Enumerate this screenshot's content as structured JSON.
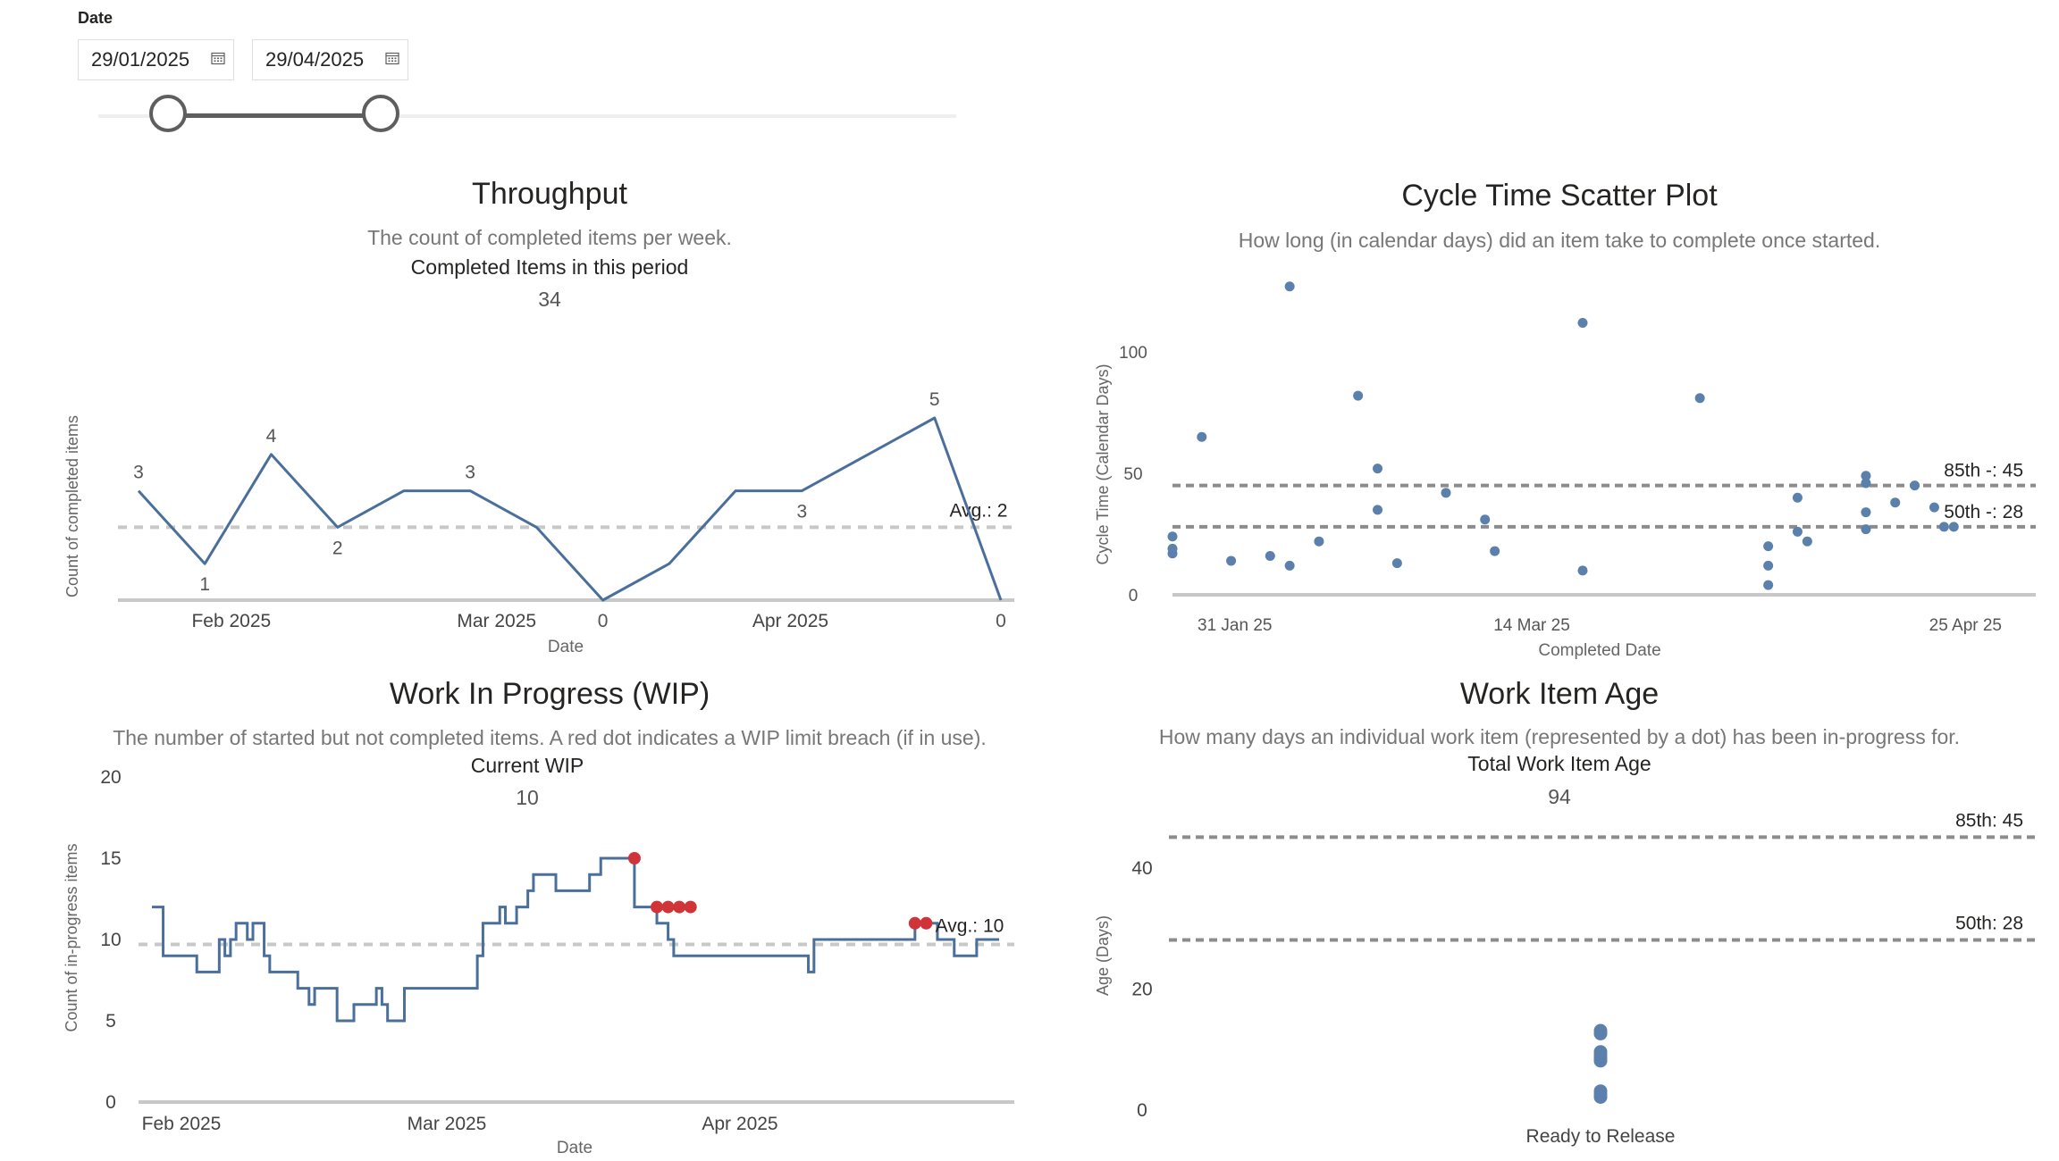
{
  "filter": {
    "label": "Date",
    "start_date": "29/01/2025",
    "end_date": "29/04/2025",
    "slider_start_fraction": 0.0,
    "slider_end_fraction": 1.0
  },
  "colors": {
    "series": "#4a6f9b",
    "dot": "#5b80ab",
    "breach": "#d13438",
    "axis": "#c8c8c8",
    "avg_line": "#c8c8c8",
    "percentile_line": "#8c8c8c"
  },
  "throughput": {
    "title": "Throughput",
    "subtitle": "The count of completed items per week.",
    "kpi_label": "Completed Items in this period",
    "kpi_value": "34"
  },
  "cycle_time": {
    "title": "Cycle Time Scatter Plot",
    "subtitle": "How long (in calendar days) did an item take to complete once started."
  },
  "wip": {
    "title": "Work In Progress (WIP)",
    "subtitle": "The number of started but not completed items. A red dot indicates a WIP limit breach (if in use).",
    "kpi_label": "Current WIP",
    "kpi_value": "10"
  },
  "work_item_age": {
    "title": "Work Item Age",
    "subtitle": "How many days an individual work item (represented by a dot) has been in-progress for.",
    "kpi_label": "Total Work Item Age",
    "kpi_value": "94"
  },
  "chart_data": [
    {
      "id": "throughput",
      "type": "line",
      "x": [
        "2025-01-29",
        "2025-02-05",
        "2025-02-12",
        "2025-02-19",
        "2025-02-26",
        "2025-03-05",
        "2025-03-12",
        "2025-03-19",
        "2025-03-26",
        "2025-04-02",
        "2025-04-09",
        "2025-04-16",
        "2025-04-23",
        "2025-04-30"
      ],
      "series": [
        {
          "values": [
            3,
            1,
            4,
            2,
            3,
            3,
            2,
            0,
            1,
            3,
            3,
            4,
            5,
            0
          ]
        }
      ],
      "data_labels": [
        {
          "index": 0,
          "text": "3"
        },
        {
          "index": 1,
          "text": "1"
        },
        {
          "index": 2,
          "text": "4"
        },
        {
          "index": 3,
          "text": "2"
        },
        {
          "index": 5,
          "text": "3"
        },
        {
          "index": 7,
          "text": "0"
        },
        {
          "index": 10,
          "text": "3"
        },
        {
          "index": 12,
          "text": "5"
        },
        {
          "index": 13,
          "text": "0"
        }
      ],
      "average": 2,
      "average_label": "Avg.: 2",
      "xlabel": "Date",
      "ylabel": "Count of completed items",
      "x_ticks": [
        "Feb 2025",
        "Mar 2025",
        "Apr 2025"
      ],
      "x_tick_dates": [
        "2025-02-01",
        "2025-03-01",
        "2025-04-01"
      ],
      "ylim": [
        0,
        5.5
      ],
      "grid": false
    },
    {
      "id": "cycle_time",
      "type": "scatter",
      "xlabel": "Completed Date",
      "ylabel": "Cycle Time (Calendar Days)",
      "x_ticks": [
        "31 Jan 25",
        "14 Mar 25",
        "25 Apr 25"
      ],
      "x_tick_dates": [
        "2025-01-31",
        "2025-03-14",
        "2025-04-25"
      ],
      "y_ticks": [
        0,
        50,
        100
      ],
      "ylim": [
        0,
        128
      ],
      "points": [
        [
          "2025-01-31",
          24
        ],
        [
          "2025-01-31",
          19
        ],
        [
          "2025-01-31",
          17
        ],
        [
          "2025-02-03",
          65
        ],
        [
          "2025-02-06",
          14
        ],
        [
          "2025-02-10",
          16
        ],
        [
          "2025-02-12",
          12
        ],
        [
          "2025-02-12",
          127
        ],
        [
          "2025-02-15",
          22
        ],
        [
          "2025-02-19",
          82
        ],
        [
          "2025-02-21",
          52
        ],
        [
          "2025-02-21",
          35
        ],
        [
          "2025-02-23",
          13
        ],
        [
          "2025-02-28",
          42
        ],
        [
          "2025-03-04",
          31
        ],
        [
          "2025-03-05",
          18
        ],
        [
          "2025-03-14",
          10
        ],
        [
          "2025-03-14",
          112
        ],
        [
          "2025-03-26",
          81
        ],
        [
          "2025-04-02",
          20
        ],
        [
          "2025-04-02",
          12
        ],
        [
          "2025-04-02",
          4
        ],
        [
          "2025-04-05",
          40
        ],
        [
          "2025-04-05",
          26
        ],
        [
          "2025-04-06",
          22
        ],
        [
          "2025-04-12",
          46
        ],
        [
          "2025-04-12",
          49
        ],
        [
          "2025-04-12",
          34
        ],
        [
          "2025-04-12",
          27
        ],
        [
          "2025-04-15",
          38
        ],
        [
          "2025-04-17",
          45
        ],
        [
          "2025-04-19",
          36
        ],
        [
          "2025-04-20",
          28
        ],
        [
          "2025-04-21",
          28
        ]
      ],
      "percentiles": [
        {
          "label": "85th -: 45",
          "value": 45
        },
        {
          "label": "50th -: 28",
          "value": 28
        }
      ],
      "grid": false
    },
    {
      "id": "wip",
      "type": "line",
      "step": true,
      "xlabel": "Date",
      "ylabel": "Count of in-progress items",
      "x_ticks": [
        "Feb 2025",
        "Mar 2025",
        "Apr 2025"
      ],
      "x_tick_dates": [
        "2025-02-01",
        "2025-03-01",
        "2025-04-01"
      ],
      "y_ticks": [
        0,
        5,
        10,
        15,
        20
      ],
      "ylim": [
        0,
        20
      ],
      "series": [
        {
          "points": [
            [
              "2025-01-29",
              12
            ],
            [
              "2025-01-31",
              9
            ],
            [
              "2025-02-06",
              8
            ],
            [
              "2025-02-10",
              10
            ],
            [
              "2025-02-11",
              9
            ],
            [
              "2025-02-12",
              10
            ],
            [
              "2025-02-13",
              11
            ],
            [
              "2025-02-15",
              10
            ],
            [
              "2025-02-16",
              11
            ],
            [
              "2025-02-18",
              9
            ],
            [
              "2025-02-19",
              8
            ],
            [
              "2025-02-24",
              7
            ],
            [
              "2025-02-26",
              6
            ],
            [
              "2025-02-27",
              7
            ],
            [
              "2025-03-03",
              5
            ],
            [
              "2025-03-06",
              6
            ],
            [
              "2025-03-10",
              7
            ],
            [
              "2025-03-11",
              6
            ],
            [
              "2025-03-12",
              5
            ],
            [
              "2025-03-15",
              7
            ],
            [
              "2025-03-28",
              9
            ],
            [
              "2025-03-29",
              11
            ],
            [
              "2025-04-01",
              12
            ],
            [
              "2025-04-02",
              11
            ],
            [
              "2025-04-04",
              12
            ],
            [
              "2025-04-06",
              13
            ],
            [
              "2025-04-07",
              14
            ],
            [
              "2025-04-11",
              13
            ],
            [
              "2025-04-17",
              14
            ],
            [
              "2025-04-19",
              15
            ],
            [
              "2025-04-25",
              12
            ],
            [
              "2025-04-29",
              11
            ],
            [
              "2025-05-01",
              10
            ],
            [
              "2025-05-02",
              9
            ],
            [
              "2025-05-26",
              8
            ],
            [
              "2025-05-27",
              10
            ],
            [
              "2025-06-14",
              11
            ],
            [
              "2025-06-18",
              10
            ],
            [
              "2025-06-21",
              9
            ],
            [
              "2025-06-25",
              10
            ],
            [
              "2025-06-29",
              10
            ]
          ]
        }
      ],
      "breaches": [
        [
          "2025-04-25",
          15
        ],
        [
          "2025-04-29",
          12
        ],
        [
          "2025-05-01",
          12
        ],
        [
          "2025-05-03",
          12
        ],
        [
          "2025-05-05",
          12
        ],
        [
          "2025-06-14",
          11
        ],
        [
          "2025-06-16",
          11
        ]
      ],
      "average": 9.7,
      "average_label": "Avg.: 10",
      "grid": false
    },
    {
      "id": "work_item_age",
      "type": "scatter",
      "xlabel": "Ready to Release",
      "ylabel": "Age (Days)",
      "y_ticks": [
        0,
        20,
        40
      ],
      "ylim": [
        0,
        52
      ],
      "values": [
        13,
        12.5,
        9.5,
        9,
        8.5,
        8,
        3,
        2.5,
        2
      ],
      "percentiles": [
        {
          "label": "85th: 45",
          "value": 45
        },
        {
          "label": "50th: 28",
          "value": 28
        }
      ],
      "grid": false
    }
  ]
}
